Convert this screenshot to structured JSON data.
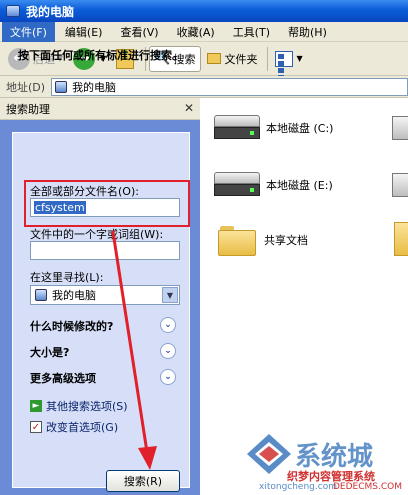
{
  "window": {
    "title": "我的电脑"
  },
  "menu": [
    "文件(F)",
    "编辑(E)",
    "查看(V)",
    "收藏(A)",
    "工具(T)",
    "帮助(H)"
  ],
  "toolbar": {
    "back_label": "后退",
    "search_label": "搜索",
    "folders_label": "文件夹"
  },
  "address": {
    "label": "地址(D)",
    "value": "我的电脑"
  },
  "search_panel": {
    "title": "搜索助理",
    "intro": "按下面任何或所有标准进行搜索。",
    "filename_label": "全部或部分文件名(O):",
    "filename_value": "cfsystem",
    "word_label": "文件中的一个字或词组(W):",
    "word_value": "",
    "look_in_label": "在这里寻找(L):",
    "look_in_value": "我的电脑",
    "section_modified": "什么时候修改的?",
    "section_size": "大小是?",
    "section_advanced": "更多高级选项",
    "link_other": "其他搜索选项(S)",
    "link_prefs": "改变首选项(G)",
    "search_button": "搜索(R)"
  },
  "items": {
    "drive_c": "本地磁盘 (C:)",
    "drive_e": "本地磁盘 (E:)",
    "shared": "共享文档"
  },
  "watermark": {
    "brand": "系统城",
    "site_cn": "织梦内容管理系统",
    "url1": "xitongcheng.com",
    "url2": "DEDECMS.COM"
  },
  "colors": {
    "title_blue": "#0a5cd8",
    "panel_blue": "#6b8bd6",
    "highlight": "#e0202a",
    "selection": "#316ac5"
  }
}
